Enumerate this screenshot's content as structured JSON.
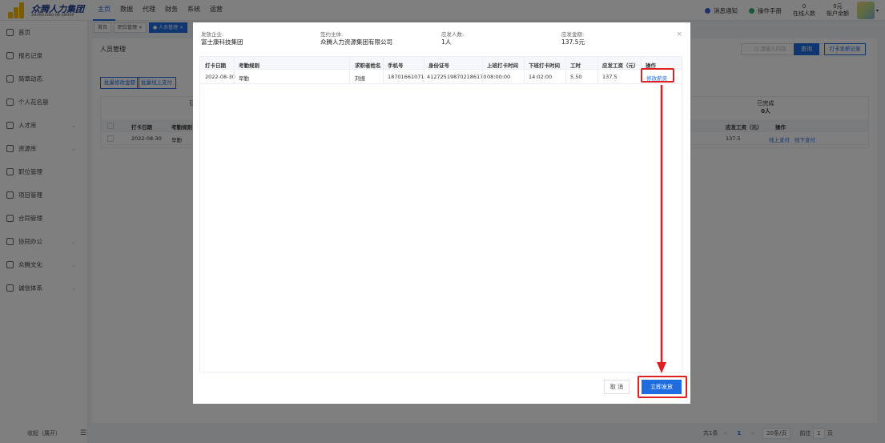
{
  "app": {
    "logo_text": "众腾人力集团",
    "logo_sub": "ZHONGTENG HR GROUP",
    "nav": [
      "主页",
      "数据",
      "代理",
      "财务",
      "系统",
      "运营"
    ],
    "notify_label": "消息通知",
    "manual_label": "操作手册",
    "online_value": "0",
    "online_label": "在线人数",
    "balance_value": "0元",
    "balance_label": "账户余额"
  },
  "sidebar": {
    "items": [
      {
        "label": "首页",
        "has_children": false
      },
      {
        "label": "报名记录",
        "has_children": false
      },
      {
        "label": "简章动态",
        "has_children": false
      },
      {
        "label": "个人花名册",
        "has_children": false
      },
      {
        "label": "人才库",
        "has_children": true
      },
      {
        "label": "资源库",
        "has_children": true
      },
      {
        "label": "职位管理",
        "has_children": false
      },
      {
        "label": "项目管理",
        "has_children": false
      },
      {
        "label": "合同管理",
        "has_children": false
      },
      {
        "label": "协同办公",
        "has_children": true
      },
      {
        "label": "众腾文化",
        "has_children": true
      },
      {
        "label": "诚信体系",
        "has_children": true
      }
    ],
    "collapse_label": "收起（展开）"
  },
  "tabs": [
    {
      "label": "首页",
      "active": false
    },
    {
      "label": "职位管理 ×",
      "active": false
    },
    {
      "label": "● 人员管理 ×",
      "active": true
    }
  ],
  "page": {
    "title": "人员管理",
    "search_placeholder": "Q 请输入内容",
    "query_button": "查询",
    "record_button": "打卡发薪记录",
    "batch_amount_button": "批量修改金额",
    "batch_offline_button": "批量线上支付",
    "completed_label": "已完成",
    "completed_count": "0人",
    "partial_label": "已",
    "bg_headers": [
      "打卡日期",
      "考勤规则",
      "应发工资（元）",
      "操作"
    ],
    "bg_row": {
      "date": "2022-08-30",
      "rule": "早勤",
      "wage": "137.5",
      "action1": "线上支付",
      "action2": "线下支付"
    }
  },
  "pager": {
    "total": "共1条",
    "prev": "<",
    "current": "1",
    "next": ">",
    "page_size": "20条/页",
    "goto_label": "前往",
    "goto_value": "1",
    "page_unit": "页"
  },
  "modal": {
    "issuer_label": "发放企业:",
    "issuer_value": "富士康科技集团",
    "signer_label": "签约主体:",
    "signer_value": "众腾人力资源集团有限公司",
    "count_label": "应发人数:",
    "count_value": "1人",
    "amount_label": "应发金额:",
    "amount_value": "137.5元",
    "close": "×",
    "headers": [
      "打卡日期",
      "考勤规则",
      "求职者姓名",
      "手机号",
      "身份证号",
      "上班打卡时间",
      "下班打卡时间",
      "工时",
      "应发工资（元）",
      "操作"
    ],
    "rows": [
      {
        "date": "2022-08-30",
        "rule": "早勤",
        "name": "刘振",
        "phone": "18701661071",
        "idcard": "412725198702186170",
        "in": "08:00:00",
        "out": "14:02:00",
        "hours": "5.50",
        "wage": "137.5",
        "action": "修改薪资"
      }
    ],
    "cancel_button": "取 消",
    "confirm_button": "立即发放"
  },
  "colors": {
    "primary": "#1e6ce0",
    "annotation": "#e02020"
  }
}
